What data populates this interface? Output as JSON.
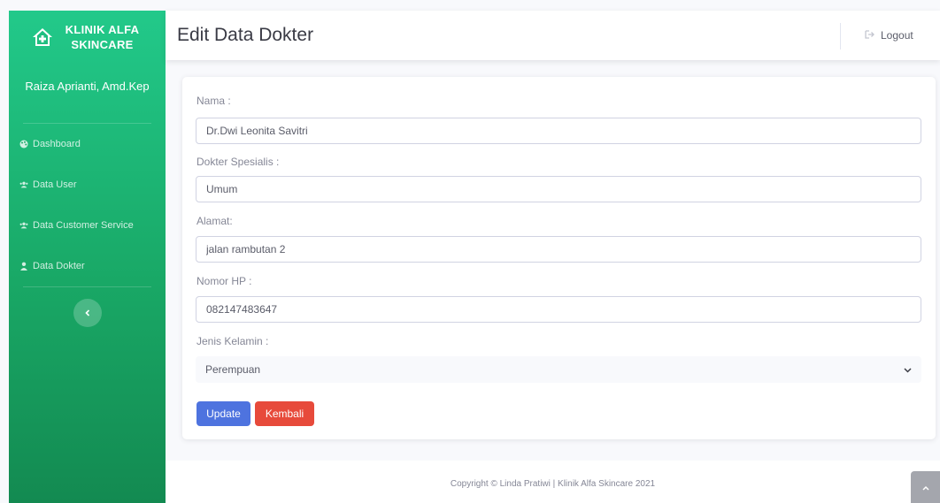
{
  "sidebar": {
    "brand_line1": "KLINIK ALFA",
    "brand_line2": "SKINCARE",
    "brand_icon": "clinic-house-icon",
    "user_name": "Raiza Aprianti, Amd.Kep",
    "items": [
      {
        "label": "Dashboard",
        "icon": "palette-icon"
      },
      {
        "label": "Data User",
        "icon": "users-icon"
      },
      {
        "label": "Data Customer Service",
        "icon": "users-icon"
      },
      {
        "label": "Data Dokter",
        "icon": "doctor-icon"
      }
    ],
    "toggle_icon": "chevron-left-icon"
  },
  "topbar": {
    "title": "Edit Data Dokter",
    "logout_label": "Logout",
    "logout_icon": "sign-out-icon"
  },
  "form": {
    "nama_label": "Nama :",
    "nama_value": "Dr.Dwi Leonita Savitri",
    "spesialis_label": "Dokter Spesialis :",
    "spesialis_value": "Umum",
    "alamat_label": "Alamat:",
    "alamat_value": "jalan rambutan 2",
    "hp_label": "Nomor HP :",
    "hp_value": "082147483647",
    "kelamin_label": "Jenis Kelamin :",
    "kelamin_value": "Perempuan",
    "update_label": "Update",
    "kembali_label": "Kembali"
  },
  "footer": {
    "copyright": "Copyright © Linda Pratiwi | Klinik Alfa Skincare 2021"
  },
  "colors": {
    "sidebar_top": "#22c98a",
    "sidebar_bottom": "#138a51",
    "primary": "#4e73df",
    "danger": "#e74a3b"
  }
}
